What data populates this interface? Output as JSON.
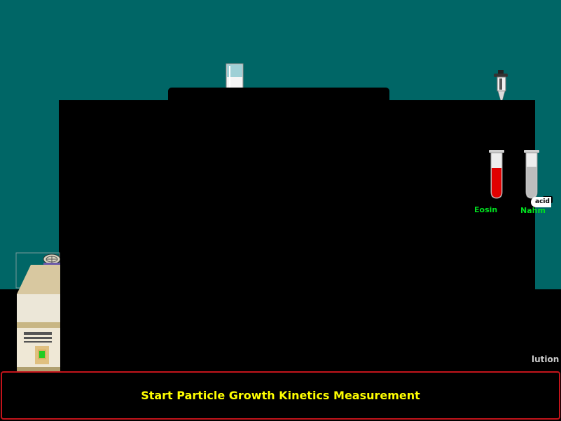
{
  "scene": {
    "colors": {
      "wall": "#006666",
      "floor": "#000000",
      "button_border": "#c4141b",
      "button_text": "#ffff00",
      "label_green": "#00e020"
    }
  },
  "reagents": {
    "eosin_label": "Eosin",
    "eosin_color": "#e00000",
    "second_label": "Nahm",
    "second_color": "#bdbdbd",
    "acid_tag": "acid"
  },
  "side_label": "lution",
  "start_button": {
    "label": "Start Particle Growth Kinetics Measurement"
  },
  "icons": [
    "cuvette-icon",
    "micropipette-icon",
    "test-tube-icon",
    "fan-icon",
    "power-led-icon"
  ]
}
